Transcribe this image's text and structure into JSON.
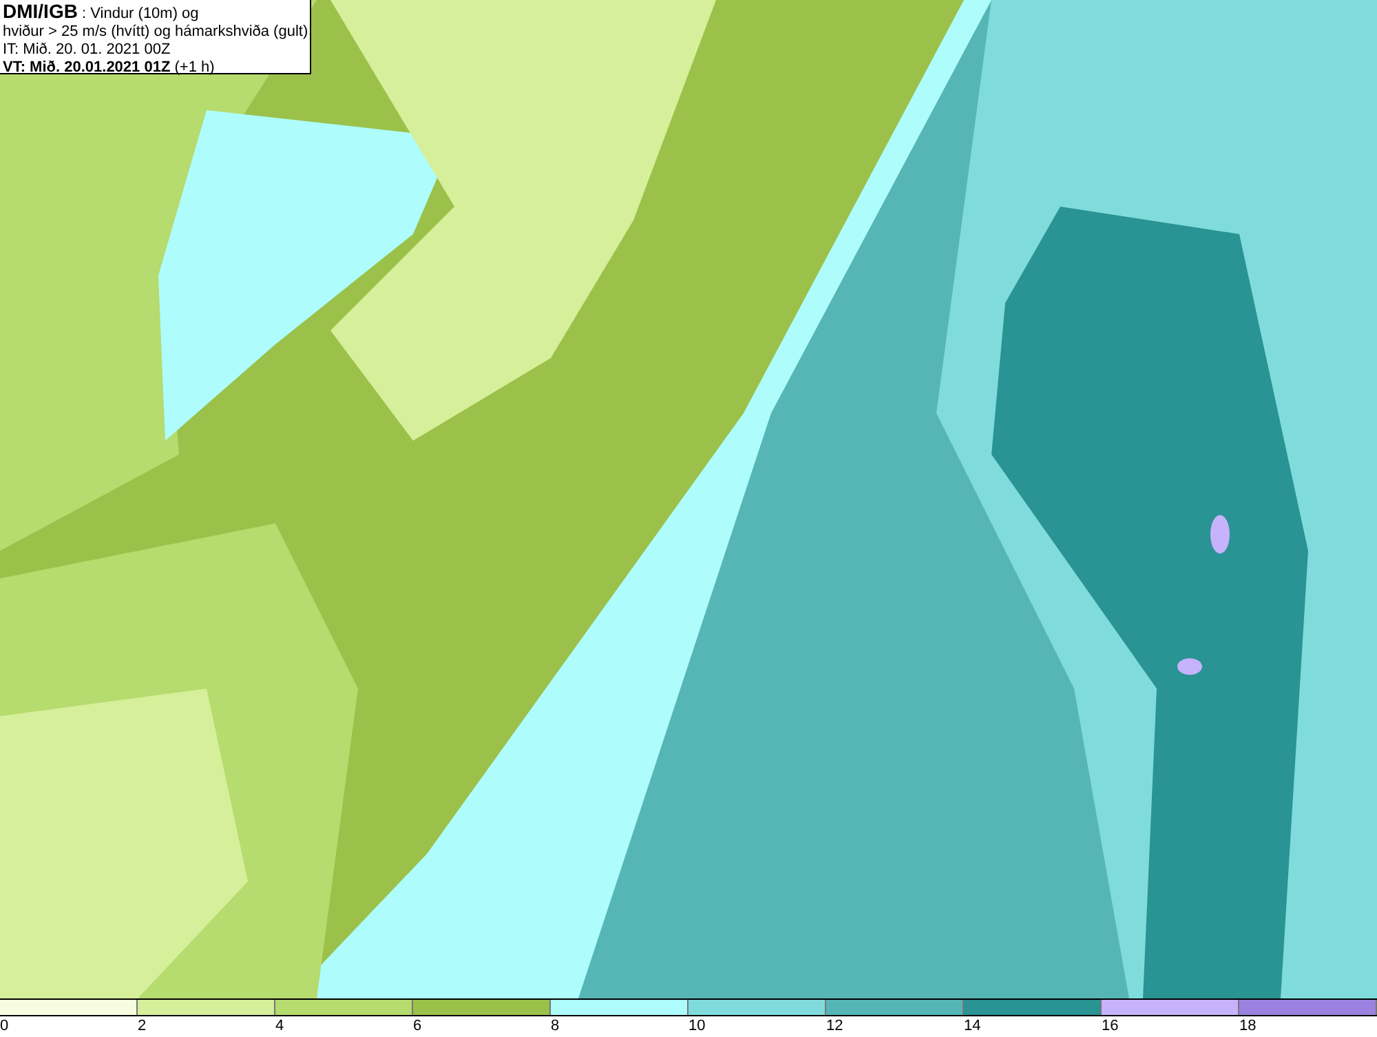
{
  "title_box": {
    "lines": [
      "**DMI/IGB** : Vindur (10m) og",
      "hviður > 25 m/s (hvítt) og hámarkshviða (gult)",
      "IT: Mið. 20. 01. 2021 00Z",
      "**VT: Mið. 20.01.2021 01Z** (+1 h)"
    ]
  },
  "legend": {
    "bins": [
      {
        "label": "0",
        "color": "#f7fde0"
      },
      {
        "label": "2",
        "color": "#d6ef9a"
      },
      {
        "label": "4",
        "color": "#b6db6e"
      },
      {
        "label": "6",
        "color": "#9bc14a"
      },
      {
        "label": "8",
        "color": "#aefcfc"
      },
      {
        "label": "10",
        "color": "#80dcdc"
      },
      {
        "label": "12",
        "color": "#56b6b6"
      },
      {
        "label": "14",
        "color": "#2a9393"
      },
      {
        "label": "16",
        "color": "#c7b2fc"
      },
      {
        "label": "18",
        "color": "#9b82e0"
      }
    ]
  }
}
